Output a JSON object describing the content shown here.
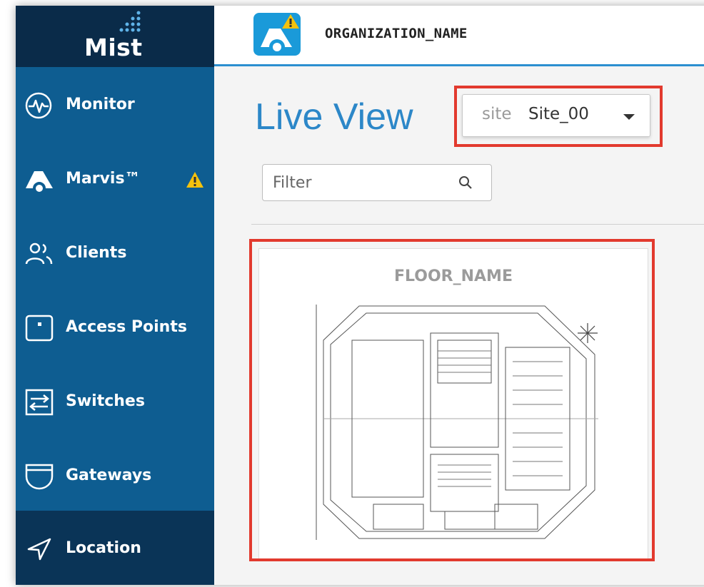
{
  "brand": {
    "logo_text": "Mist"
  },
  "sidebar": {
    "items": [
      {
        "label": "Monitor",
        "icon": "monitor-icon"
      },
      {
        "label": "Marvis™",
        "icon": "marvis-icon",
        "badge": "warning-icon"
      },
      {
        "label": "Clients",
        "icon": "clients-icon"
      },
      {
        "label": "Access Points",
        "icon": "access-point-icon"
      },
      {
        "label": "Switches",
        "icon": "switch-icon"
      },
      {
        "label": "Gateways",
        "icon": "gateway-icon"
      },
      {
        "label": "Location",
        "icon": "location-icon",
        "active": true
      }
    ]
  },
  "header": {
    "org_name": "ORGANIZATION_NAME"
  },
  "main": {
    "title": "Live View",
    "site_select": {
      "prefix": "site",
      "value": "Site_00"
    },
    "filter": {
      "placeholder": "Filter"
    },
    "floor": {
      "name": "FLOOR_NAME"
    }
  },
  "colors": {
    "sidebar": "#0e5d91",
    "sidebar_dark": "#0a2b49",
    "active": "#0a3457",
    "accent": "#2c87c8",
    "highlight": "#e23a2e",
    "warning": "#f4c20d"
  }
}
